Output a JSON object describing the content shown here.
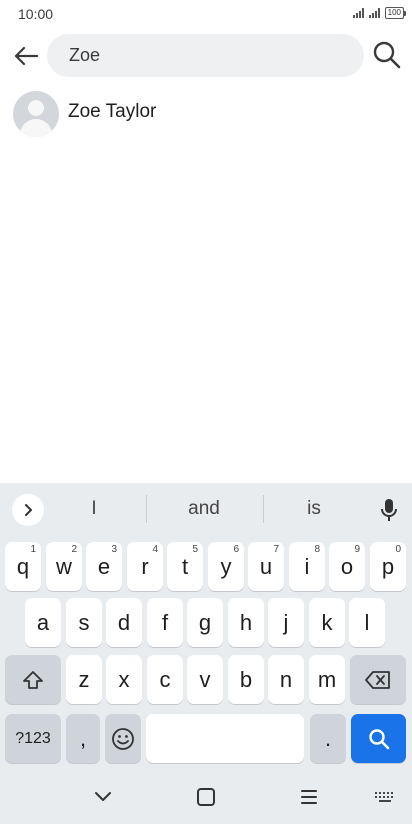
{
  "status_bar": {
    "time": "10:00",
    "battery": "100"
  },
  "search": {
    "query": "Zoe"
  },
  "results": [
    {
      "name": "Zoe Taylor"
    }
  ],
  "keyboard": {
    "suggestions": [
      "I",
      "and",
      "is"
    ],
    "row1": [
      {
        "label": "q",
        "hint": "1"
      },
      {
        "label": "w",
        "hint": "2"
      },
      {
        "label": "e",
        "hint": "3"
      },
      {
        "label": "r",
        "hint": "4"
      },
      {
        "label": "t",
        "hint": "5"
      },
      {
        "label": "y",
        "hint": "6"
      },
      {
        "label": "u",
        "hint": "7"
      },
      {
        "label": "i",
        "hint": "8"
      },
      {
        "label": "o",
        "hint": "9"
      },
      {
        "label": "p",
        "hint": "0"
      }
    ],
    "row2": [
      "a",
      "s",
      "d",
      "f",
      "g",
      "h",
      "j",
      "k",
      "l"
    ],
    "row3": [
      "z",
      "x",
      "c",
      "v",
      "b",
      "n",
      "m"
    ],
    "symbols_label": "?123",
    "comma_label": ",",
    "period_label": ".",
    "accent_color": "#1a73e8"
  }
}
